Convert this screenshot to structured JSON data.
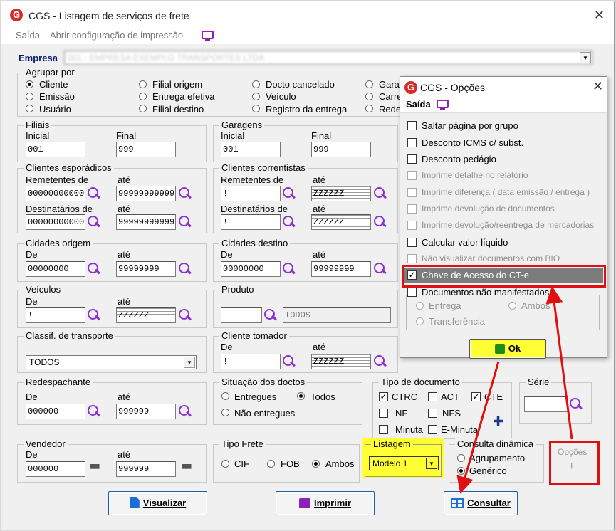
{
  "window": {
    "title": "CGS - Listagem de serviços de frete",
    "close": "✕"
  },
  "menu": {
    "saida": "Saída",
    "config": "Abrir configuração de impressão"
  },
  "empresa": {
    "label": "Empresa",
    "value": "001 - EMPRESA EXEMPLO TRANSPORTES LTDA"
  },
  "agrupar": {
    "title": "Agrupar por",
    "options": [
      "Cliente",
      "Emissão",
      "Usuário",
      "Filial origem",
      "Entrega efetiva",
      "Filial destino",
      "Docto cancelado",
      "Veículo",
      "Registro da entrega",
      "Garag",
      "Carre",
      "Rede"
    ]
  },
  "filiais": {
    "title": "Filiais",
    "inicial_label": "Inicial",
    "final_label": "Final",
    "inicial": "001",
    "final": "999"
  },
  "garagens": {
    "title": "Garagens",
    "inicial_label": "Inicial",
    "final_label": "Final",
    "inicial": "001",
    "final": "999"
  },
  "esporadicos": {
    "title": "Clientes esporádicos",
    "rem_label": "Remetentes de",
    "ate": "até",
    "dest_label": "Destinatários de",
    "rem_de": "00000000000",
    "rem_ate": "99999999999",
    "dest_de": "00000000000",
    "dest_ate": "99999999999"
  },
  "correntistas": {
    "title": "Clientes correntistas",
    "rem_label": "Remetentes de",
    "ate": "até",
    "dest_label": "Destinatários de",
    "rem_de": "!",
    "rem_ate": "ZZZZZZ",
    "dest_de": "!",
    "dest_ate": "ZZZZZZ"
  },
  "cid_origem": {
    "title": "Cidades origem",
    "de_label": "De",
    "ate": "até",
    "de": "00000000",
    "ate_val": "99999999"
  },
  "cid_destino": {
    "title": "Cidades destino",
    "de_label": "De",
    "ate": "até",
    "de": "00000000",
    "ate_val": "99999999"
  },
  "veiculos": {
    "title": "Veículos",
    "de_label": "De",
    "ate": "até",
    "de": "!",
    "ate_val": "ZZZZZZ"
  },
  "produto": {
    "title": "Produto",
    "value": "TODOS"
  },
  "classif": {
    "title": "Classif. de transporte",
    "value": "TODOS"
  },
  "tomador": {
    "title": "Cliente tomador",
    "de_label": "De",
    "ate": "até",
    "de": "!",
    "ate_val": "ZZZZZZ"
  },
  "redespachante": {
    "title": "Redespachante",
    "de_label": "De",
    "ate": "até",
    "de": "000000",
    "ate_val": "999999"
  },
  "situacao": {
    "title": "Situação dos doctos",
    "entregues": "Entregues",
    "todos": "Todos",
    "nao": "Não entregues"
  },
  "tipo_doc": {
    "title": "Tipo de documento",
    "items": [
      "CTRC",
      "ACT",
      "CTE",
      "NF",
      "NFS",
      "Minuta",
      "E-Minuta"
    ]
  },
  "serie": {
    "title": "Série"
  },
  "vendedor": {
    "title": "Vendedor",
    "de_label": "De",
    "ate": "até",
    "de": "000000",
    "ate_val": "999999"
  },
  "tipo_frete": {
    "title": "Tipo Frete",
    "cif": "CIF",
    "fob": "FOB",
    "ambos": "Ambos"
  },
  "listagem": {
    "title": "Listagem",
    "value": "Modelo 1"
  },
  "consulta": {
    "title": "Consulta dinâmica",
    "agrup": "Agrupamento",
    "gen": "Genérico"
  },
  "opcoes_btn": {
    "label": "Opções",
    "plus": "+"
  },
  "buttons": {
    "visualizar": "Visualizar",
    "imprimir": "Imprimir",
    "consultar": "Consultar"
  },
  "dialog": {
    "title": "CGS - Opções",
    "menu": "Saída",
    "items": [
      "Saltar página por grupo",
      "Desconto ICMS c/ subst.",
      "Desconto pedágio",
      "Imprime detalhe no relatório",
      "Imprime diferença ( data emissão / entrega )",
      "Imprime devolução de documentos",
      "Imprime devolução/reentrega de mercadorias",
      "Calcular valor líquido",
      "Não visualizar documentos com BIO",
      "Chave de Acesso do CT-e",
      "Documentos não manifestados"
    ],
    "entrega": "Entrega",
    "ambos": "Ambos",
    "transf": "Transferência",
    "ok": "Ok"
  },
  "colors": {
    "accent": "#8b2fd0",
    "highlight": "#ffff33",
    "annotation": "#e01010"
  }
}
